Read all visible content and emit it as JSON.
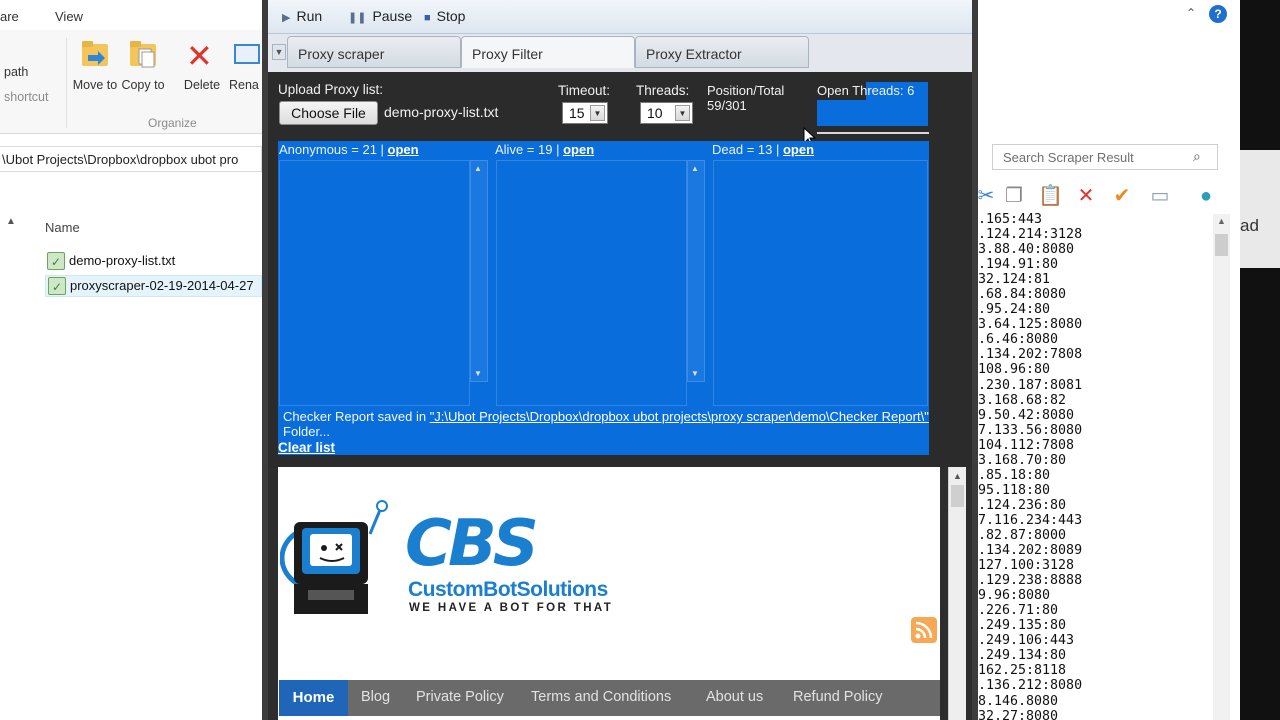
{
  "explorer": {
    "tabs": [
      "are",
      "View"
    ],
    "ribbon": {
      "path_label": "path",
      "shortcut_label": "shortcut",
      "move_to": "Move to",
      "copy_to": "Copy to",
      "delete": "Delete",
      "rename": "Rena",
      "group_organize": "Organize"
    },
    "address": "\\Ubot Projects\\Dropbox\\dropbox ubot pro",
    "column_name": "Name",
    "files": [
      "demo-proxy-list.txt",
      "proxyscraper-02-19-2014-04-27"
    ]
  },
  "app": {
    "toolbar": {
      "run": "Run",
      "pause": "Pause",
      "stop": "Stop"
    },
    "tabs": [
      "Proxy scraper",
      "Proxy Filter",
      "Proxy Extractor"
    ],
    "active_tab": "Proxy Filter",
    "upload_label": "Upload Proxy list:",
    "choose_file": "Choose File",
    "file_name": "demo-proxy-list.txt",
    "timeout_label": "Timeout:",
    "timeout_value": "15",
    "threads_label": "Threads:",
    "threads_value": "10",
    "position_label": "Position/Total",
    "position_value": "59/301",
    "open_threads": "Open Threads: 6",
    "columns": [
      {
        "label": "Anonymous = 21 |",
        "link": "open"
      },
      {
        "label": "Alive = 19 |",
        "link": "open"
      },
      {
        "label": "Dead = 13 |",
        "link": "open"
      }
    ],
    "report_prefix": "Checker Report saved in ",
    "report_path": "\"J:\\Ubot Projects\\Dropbox\\dropbox ubot projects\\proxy scraper\\demo\\Checker Report\\\"",
    "report_suffix": " Folder...",
    "clear_list": "Clear list",
    "web": {
      "logo_letters": "CBS",
      "logo_name": "CustomBotSolutions",
      "tagline": "WE HAVE A BOT FOR THAT",
      "nav": [
        "Home",
        "Blog",
        "Private Policy",
        "Terms and Conditions",
        "About us",
        "Refund Policy"
      ]
    }
  },
  "right": {
    "search_placeholder": "Search Scraper Result",
    "partial_text": "ad",
    "proxies": [
      ".165:443",
      ".124.214:3128",
      "3.88.40:8080",
      ".194.91:80",
      "32.124:81",
      ".68.84:8080",
      ".95.24:80",
      "3.64.125:8080",
      ".6.46:8080",
      ".134.202:7808",
      "108.96:80",
      ".230.187:8081",
      "3.168.68:82",
      "9.50.42:8080",
      "7.133.56:8080",
      "104.112:7808",
      "3.168.70:80",
      ".85.18:80",
      "95.118:80",
      ".124.236:80",
      "7.116.234:443",
      ".82.87:8000",
      ".134.202:8089",
      "127.100:3128",
      ".129.238:8888",
      "9.96:8080",
      ".226.71:80",
      ".249.135:80",
      ".249.106:443",
      ".249.134:80",
      "162.25:8118",
      ".136.212:8080",
      "8.146.8080",
      "32.27:8080"
    ]
  },
  "colors": {
    "accent_blue": "#0a6ddc",
    "nav_active": "#1f66b8",
    "brand_blue": "#1b7fd0"
  }
}
